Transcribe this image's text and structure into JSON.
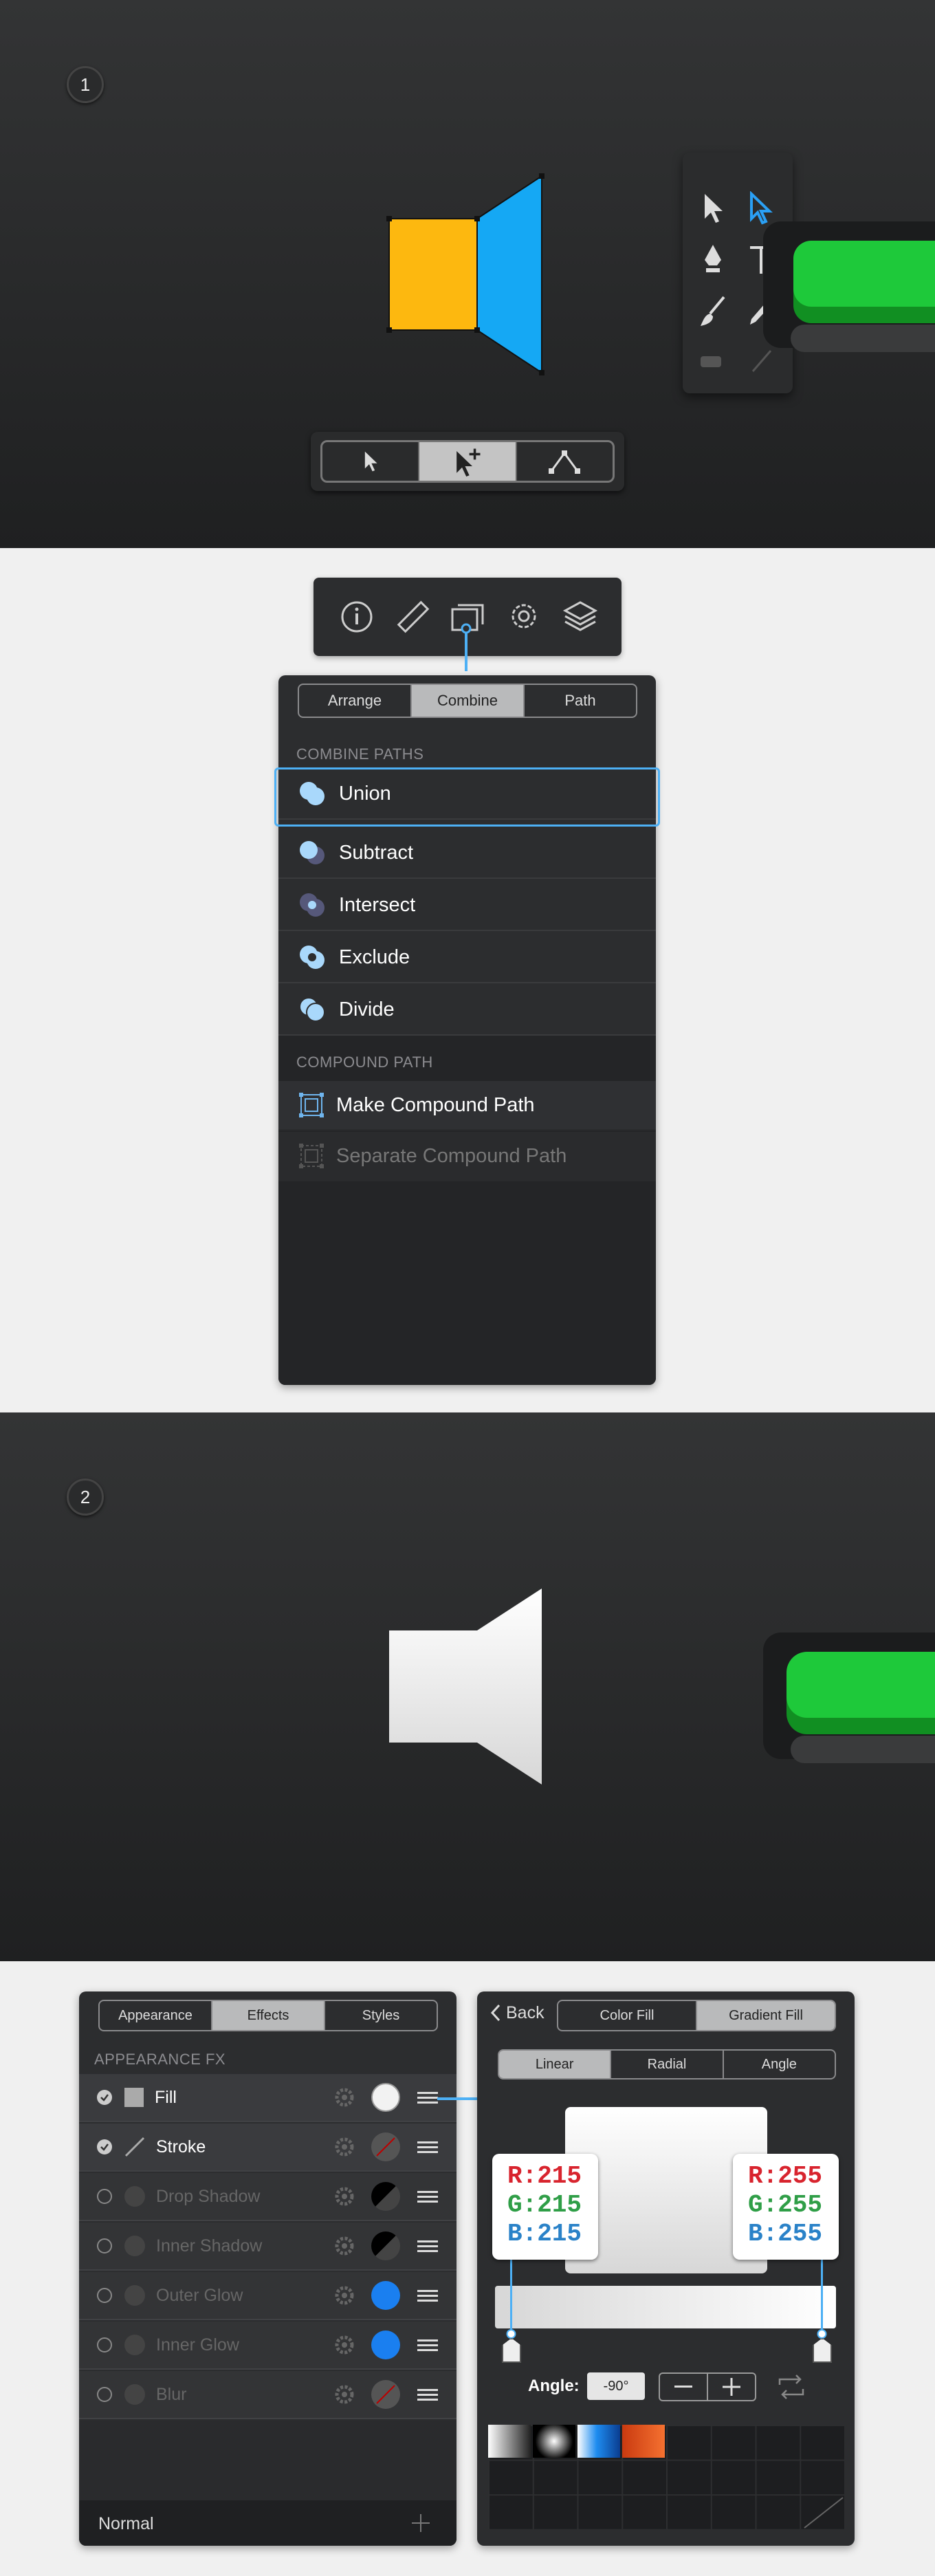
{
  "step1": {
    "badge": "1"
  },
  "step2": {
    "badge": "2"
  },
  "colors": {
    "orange": "#FDB80F",
    "blue": "#15A8F4",
    "green": "#1FCE3A",
    "accent": "#4DB0F5",
    "panel": "#2C2D2F"
  },
  "selection_modes": {
    "icons": [
      "arrow-cursor-icon",
      "arrow-plus-cursor-icon",
      "node-path-icon"
    ],
    "active": 1
  },
  "inspector_icons": [
    "info-icon",
    "ruler-icon",
    "copy-stack-icon",
    "gear-icon",
    "layers-icon"
  ],
  "combine_panel": {
    "tabs": [
      "Arrange",
      "Combine",
      "Path"
    ],
    "active_tab": "Combine",
    "header_paths": "COMBINE PATHS",
    "items": [
      "Union",
      "Subtract",
      "Intersect",
      "Exclude",
      "Divide"
    ],
    "selected": "Union",
    "header_compound": "COMPOUND PATH",
    "compound_items": [
      "Make Compound Path",
      "Separate Compound Path"
    ]
  },
  "effects_panel": {
    "tabs": [
      "Appearance",
      "Effects",
      "Styles"
    ],
    "active_tab": "Effects",
    "header": "APPEARANCE FX",
    "rows": [
      {
        "label": "Fill",
        "enabled": true
      },
      {
        "label": "Stroke",
        "enabled": true
      },
      {
        "label": "Drop Shadow",
        "enabled": false
      },
      {
        "label": "Inner Shadow",
        "enabled": false
      },
      {
        "label": "Outer Glow",
        "enabled": false
      },
      {
        "label": "Inner Glow",
        "enabled": false
      },
      {
        "label": "Blur",
        "enabled": false
      }
    ],
    "blend_mode": "Normal"
  },
  "gradient_panel": {
    "back": "Back",
    "tabs": [
      "Color Fill",
      "Gradient Fill"
    ],
    "active_tab": "Gradient Fill",
    "type_tabs": [
      "Linear",
      "Radial",
      "Angle"
    ],
    "active_type": "Linear",
    "left_stop": {
      "r": "R:215",
      "g": "G:215",
      "b": "B:215"
    },
    "right_stop": {
      "r": "R:255",
      "g": "G:255",
      "b": "B:255"
    },
    "angle_label": "Angle:",
    "angle_value": "-90°"
  }
}
